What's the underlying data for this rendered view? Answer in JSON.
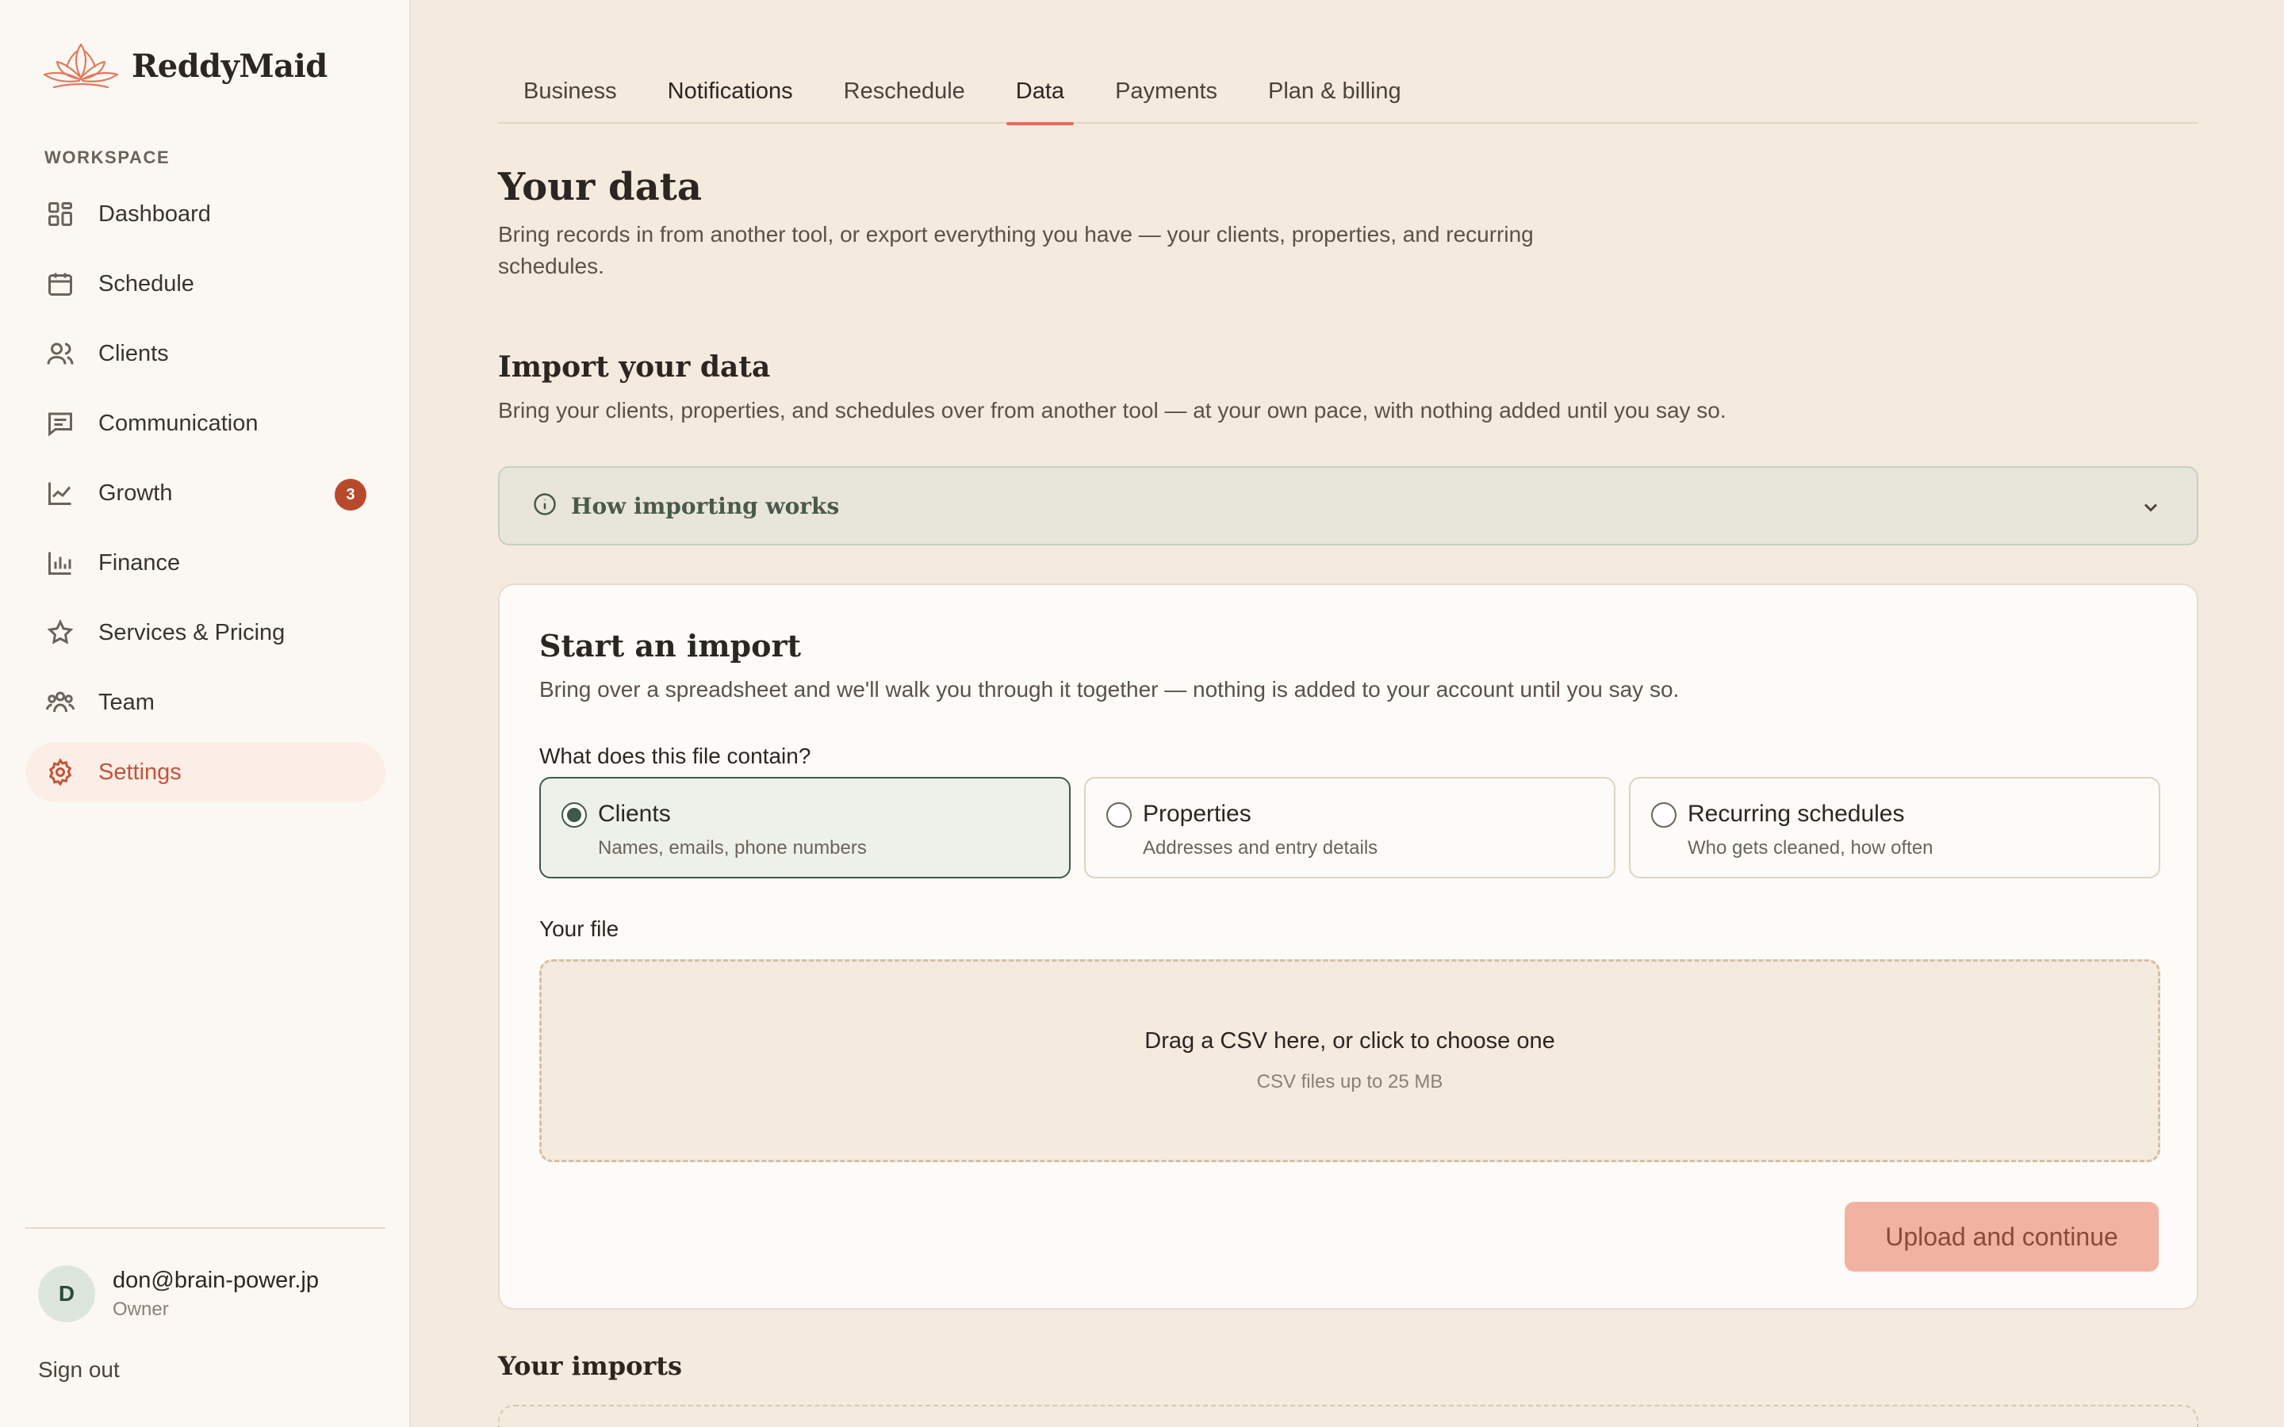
{
  "brand": {
    "name": "ReddyMaid"
  },
  "sidebar": {
    "section_label": "WORKSPACE",
    "items": [
      {
        "label": "Dashboard",
        "icon": "dashboard-icon"
      },
      {
        "label": "Schedule",
        "icon": "calendar-icon"
      },
      {
        "label": "Clients",
        "icon": "users-icon"
      },
      {
        "label": "Communication",
        "icon": "message-icon"
      },
      {
        "label": "Growth",
        "icon": "chart-line-icon",
        "badge": "3"
      },
      {
        "label": "Finance",
        "icon": "bar-chart-icon"
      },
      {
        "label": "Services & Pricing",
        "icon": "star-icon"
      },
      {
        "label": "Team",
        "icon": "team-icon"
      },
      {
        "label": "Settings",
        "icon": "gear-icon",
        "active": true
      }
    ],
    "user": {
      "initial": "D",
      "email": "don@brain-power.jp",
      "role": "Owner"
    },
    "signout": "Sign out"
  },
  "tabs": [
    {
      "label": "Business"
    },
    {
      "label": "Notifications"
    },
    {
      "label": "Reschedule"
    },
    {
      "label": "Data",
      "active": true
    },
    {
      "label": "Payments"
    },
    {
      "label": "Plan & billing"
    }
  ],
  "page": {
    "title": "Your data",
    "description": "Bring records in from another tool, or export everything you have — your clients, properties, and recurring schedules."
  },
  "import_section": {
    "title": "Import your data",
    "description": "Bring your clients, properties, and schedules over from another tool — at your own pace, with nothing added until you say so.",
    "accordion_label": "How importing works"
  },
  "import_card": {
    "title": "Start an import",
    "description": "Bring over a spreadsheet and we'll walk you through it together — nothing is added to your account until you say so.",
    "question": "What does this file contain?",
    "options": [
      {
        "title": "Clients",
        "subtitle": "Names, emails, phone numbers",
        "selected": true
      },
      {
        "title": "Properties",
        "subtitle": "Addresses and entry details",
        "selected": false
      },
      {
        "title": "Recurring schedules",
        "subtitle": "Who gets cleaned, how often",
        "selected": false
      }
    ],
    "file_label": "Your file",
    "dropzone_main": "Drag a CSV here, or click to choose one",
    "dropzone_sub": "CSV files up to 25 MB",
    "upload_button": "Upload and continue"
  },
  "imports": {
    "title": "Your imports"
  },
  "colors": {
    "accent": "#d8735a",
    "selected": "#3f5a48",
    "badge": "#b84a2c"
  }
}
